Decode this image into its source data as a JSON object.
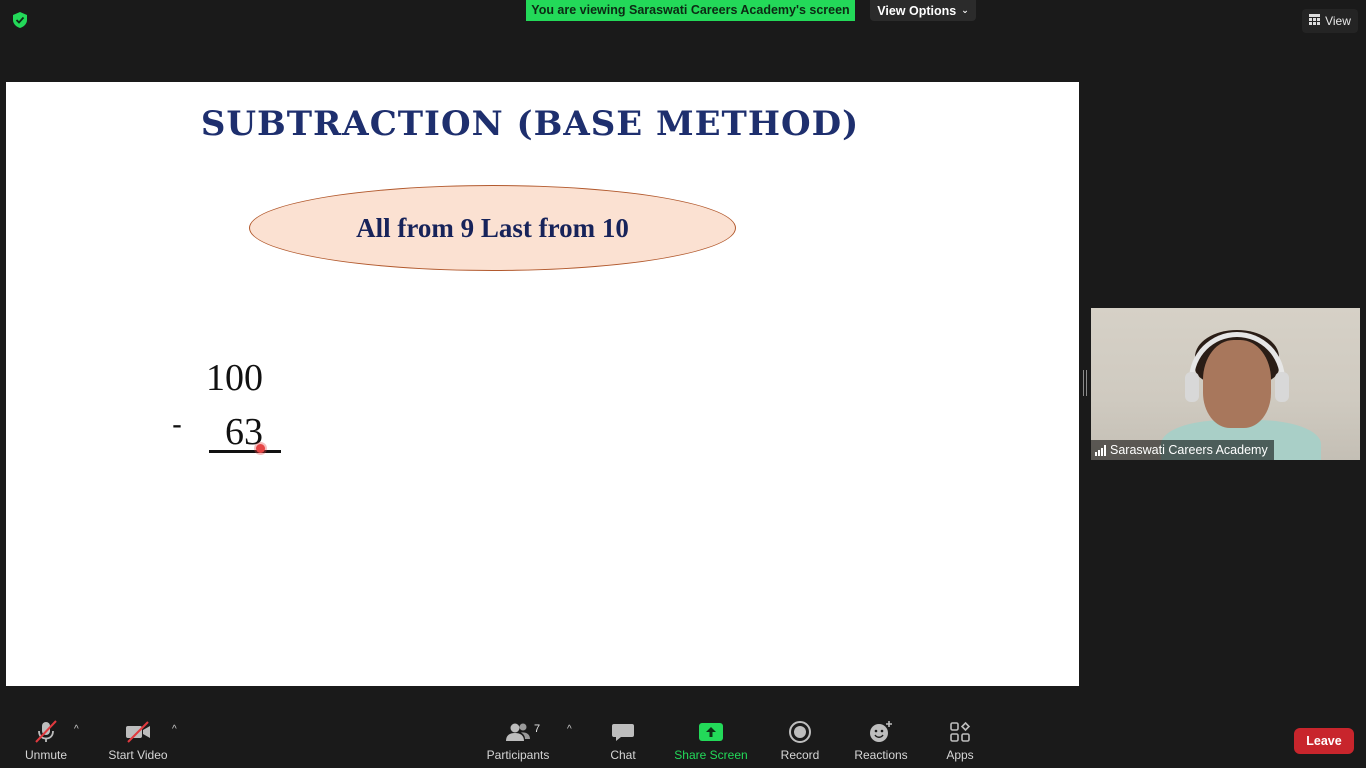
{
  "top_bar": {
    "security_icon": "shield-check-icon",
    "viewing_banner": "You are viewing Saraswati Careers Academy's screen",
    "view_options_label": "View Options",
    "view_button_label": "View"
  },
  "slide": {
    "title": "SUBTRACTION (BASE METHOD)",
    "rule_text": "All from 9 Last from 10",
    "minuend": "100",
    "operator": "-",
    "subtrahend": "63",
    "colors": {
      "title": "#1e2f6e",
      "ellipse_fill": "#fbe1d2",
      "ellipse_border": "#b2592d"
    }
  },
  "participant_tile": {
    "name": "Saraswati Careers Academy"
  },
  "toolbar": {
    "unmute_label": "Unmute",
    "start_video_label": "Start Video",
    "participants_label": "Participants",
    "participants_count": "7",
    "chat_label": "Chat",
    "share_screen_label": "Share Screen",
    "record_label": "Record",
    "reactions_label": "Reactions",
    "apps_label": "Apps",
    "leave_label": "Leave",
    "colors": {
      "share_green": "#23d959",
      "leave_red": "#c8252c",
      "muted_slash": "#e0393e"
    }
  }
}
